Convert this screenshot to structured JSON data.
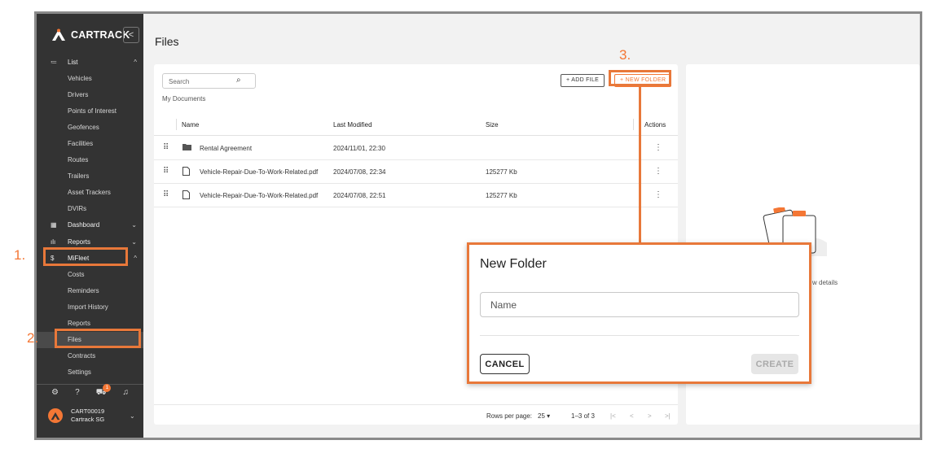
{
  "app": {
    "brand": "CARTRACK",
    "collapse_glyph": "<",
    "accent": "#f47735"
  },
  "sidebar": {
    "sections": [
      {
        "label": "List",
        "icon": "list-icon",
        "glyph": "≔",
        "chevron": "^",
        "kind": "top"
      },
      {
        "label": "Vehicles",
        "kind": "sub"
      },
      {
        "label": "Drivers",
        "kind": "sub"
      },
      {
        "label": "Points of Interest",
        "kind": "sub"
      },
      {
        "label": "Geofences",
        "kind": "sub"
      },
      {
        "label": "Facilities",
        "kind": "sub"
      },
      {
        "label": "Routes",
        "kind": "sub"
      },
      {
        "label": "Trailers",
        "kind": "sub"
      },
      {
        "label": "Asset Trackers",
        "kind": "sub"
      },
      {
        "label": "DVIRs",
        "kind": "sub"
      },
      {
        "label": "Dashboard",
        "icon": "dashboard-icon",
        "glyph": "▦",
        "chevron": "⌄",
        "kind": "top"
      },
      {
        "label": "Reports",
        "icon": "bar-chart-icon",
        "glyph": "ılı",
        "chevron": "⌄",
        "kind": "top"
      },
      {
        "label": "MiFleet",
        "icon": "dollar-icon",
        "glyph": "$",
        "chevron": "^",
        "kind": "top"
      },
      {
        "label": "Costs",
        "kind": "sub"
      },
      {
        "label": "Reminders",
        "kind": "sub"
      },
      {
        "label": "Import History",
        "kind": "sub"
      },
      {
        "label": "Reports",
        "kind": "sub"
      },
      {
        "label": "Files",
        "kind": "sub",
        "active": true
      },
      {
        "label": "Contracts",
        "kind": "sub"
      },
      {
        "label": "Settings",
        "kind": "sub"
      }
    ],
    "bottom_icons": [
      "settings-icon",
      "help-icon",
      "vehicle-alert-icon",
      "bell-icon"
    ],
    "bottom_glyphs": [
      "⚙",
      "?",
      "⛟",
      "♫"
    ],
    "notification_count": "1",
    "user": {
      "account": "CART00019",
      "company": "Cartrack SG"
    }
  },
  "page": {
    "title": "Files"
  },
  "toolbar": {
    "search_placeholder": "Search",
    "add_file": "+  ADD FILE",
    "new_folder": "+  NEW FOLDER"
  },
  "breadcrumb": "My Documents",
  "table": {
    "columns": [
      "Name",
      "Last Modified",
      "Size",
      "Actions"
    ],
    "rows": [
      {
        "name": "Rental Agreement",
        "type": "folder",
        "modified": "2024/11/01, 22:30",
        "size": ""
      },
      {
        "name": "Vehicle-Repair-Due-To-Work-Related.pdf",
        "type": "file",
        "modified": "2024/07/08, 22:34",
        "size": "125277 Kb"
      },
      {
        "name": "Vehicle-Repair-Due-To-Work-Related.pdf",
        "type": "file",
        "modified": "2024/07/08, 22:51",
        "size": "125277 Kb"
      }
    ]
  },
  "pagination": {
    "rows_per_page_label": "Rows per page:",
    "rows_per_page_value": "25",
    "range": "1–3 of 3",
    "controls": [
      "|<",
      "<",
      ">",
      ">|"
    ]
  },
  "details_panel": {
    "text": "w details"
  },
  "steps": {
    "one": "1.",
    "two": "2.",
    "three": "3."
  },
  "dialog": {
    "title": "New Folder",
    "name_placeholder": "Name",
    "cancel": "CANCEL",
    "create": "CREATE"
  }
}
